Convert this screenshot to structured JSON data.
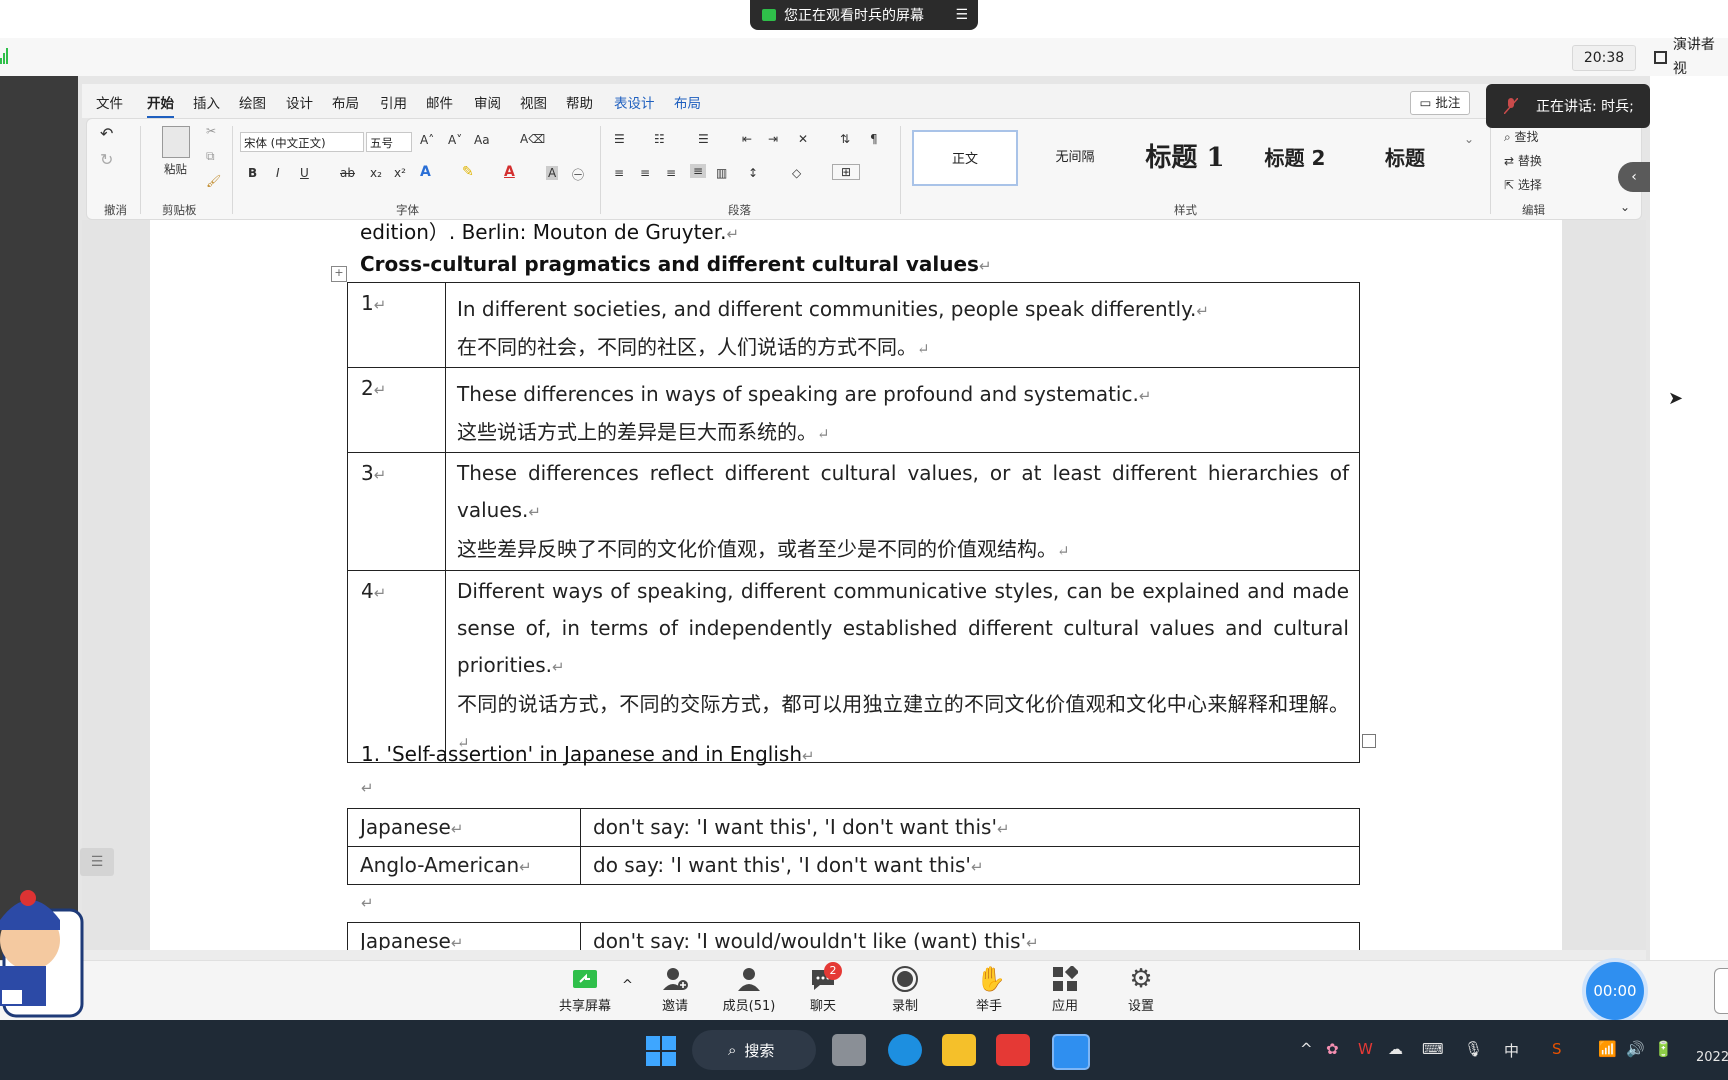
{
  "meeting": {
    "share_banner": "您正在观看时兵的屏幕",
    "clock": "20:38",
    "presenter_view": "演讲者视",
    "speaking": "正在讲话: 时兵;",
    "timer": "00:00"
  },
  "ribbon": {
    "tabs": [
      "文件",
      "开始",
      "插入",
      "绘图",
      "设计",
      "布局",
      "引用",
      "邮件",
      "审阅",
      "视图",
      "帮助",
      "表设计",
      "布局"
    ],
    "comment_button": "批注",
    "font_name": "宋体 (中文正文)",
    "font_size": "五号",
    "group_labels": {
      "undo": "撤消",
      "clipboard": "剪贴板",
      "font": "字体",
      "paragraph": "段落",
      "styles": "样式",
      "editing": "编辑"
    },
    "paste_label": "粘贴",
    "styles": [
      "正文",
      "无间隔",
      "标题 1",
      "标题 2",
      "标题"
    ],
    "edit_items": [
      "查找",
      "替换",
      "选择"
    ]
  },
  "document": {
    "prev_line": "edition）. Berlin: Mouton de Gruyter.",
    "heading": "Cross-cultural pragmatics and different cultural values",
    "rows": [
      {
        "num": "1",
        "en": "In different societies, and different communities, people speak differently.",
        "cn": "在不同的社会，不同的社区，人们说话的方式不同。"
      },
      {
        "num": "2",
        "en": "These differences in ways of speaking are profound and systematic.",
        "cn": "这些说话方式上的差异是巨大而系统的。"
      },
      {
        "num": "3",
        "en": "These differences reflect different cultural values, or at least different hierarchies of values.",
        "cn": "这些差异反映了不同的文化价值观，或者至少是不同的价值观结构。"
      },
      {
        "num": "4",
        "en": "Different ways of speaking, different communicative styles, can be explained and made sense of, in terms of independently established different cultural values and cultural priorities.",
        "cn": "不同的说话方式，不同的交际方式，都可以用独立建立的不同文化价值观和文化中心来解释和理解。"
      }
    ],
    "section": "1. 'Self-assertion' in Japanese and in English",
    "table2": [
      {
        "left": "Japanese",
        "right": "don't say: 'I want this', 'I don't want this'"
      },
      {
        "left": "Anglo-American",
        "right": "do say: 'I want this', 'I don't want this'"
      }
    ],
    "table3": [
      {
        "left": "Japanese",
        "right": "don't say: 'I would/wouldn't like (want) this'"
      }
    ]
  },
  "toolbar": {
    "items": [
      "共享屏幕",
      "邀请",
      "成员(51)",
      "聊天",
      "录制",
      "举手",
      "应用",
      "设置"
    ],
    "chat_badge": "2"
  },
  "taskbar": {
    "search": "搜索",
    "ime": "中",
    "date_partial": "2022"
  }
}
